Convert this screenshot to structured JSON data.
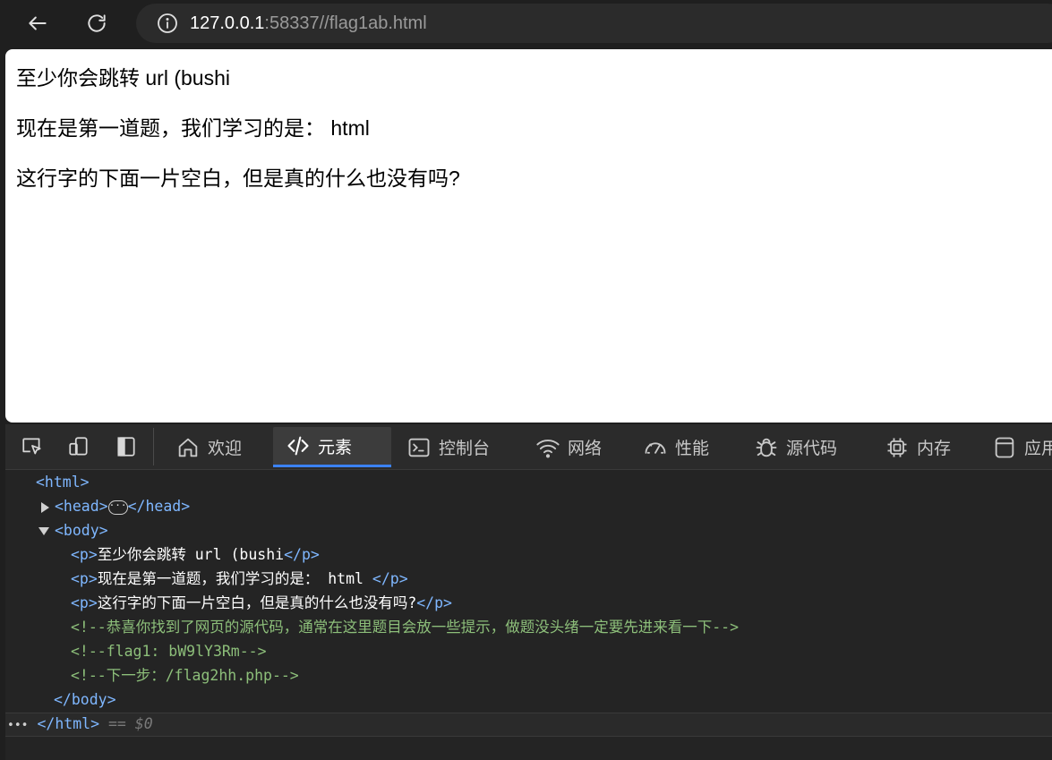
{
  "browser": {
    "url_host": "127.0.0.1",
    "url_rest": ":58337//flag1ab.html",
    "icons": {
      "back": "back-arrow-icon",
      "reload": "reload-icon",
      "info": "info-icon"
    }
  },
  "page": {
    "lines": [
      "至少你会跳转 url (bushi",
      "现在是第一道题，我们学习的是： html",
      "这行字的下面一片空白，但是真的什么也没有吗?"
    ]
  },
  "devtools": {
    "tabs": [
      {
        "label": "欢迎",
        "icon": "home-icon"
      },
      {
        "label": "元素",
        "icon": "code-icon"
      },
      {
        "label": "控制台",
        "icon": "console-icon"
      },
      {
        "label": "网络",
        "icon": "wifi-icon"
      },
      {
        "label": "性能",
        "icon": "gauge-icon"
      },
      {
        "label": "源代码",
        "icon": "bug-icon"
      },
      {
        "label": "内存",
        "icon": "chip-icon"
      },
      {
        "label": "应用",
        "icon": "app-icon"
      }
    ],
    "active_tab": "元素",
    "dom": {
      "html_open": "<html>",
      "head_open": "<head>",
      "head_ellipsis": "···",
      "head_close": "</head>",
      "body_open": "<body>",
      "p_open": "<p>",
      "p_close": "</p>",
      "p1_text": "至少你会跳转 url (bushi",
      "p2_text": "现在是第一道题，我们学习的是： html ",
      "p3_text": "这行字的下面一片空白，但是真的什么也没有吗?",
      "comment1": "<!--恭喜你找到了网页的源代码，通常在这里题目会放一些提示，做题没头绪一定要先进来看一下-->",
      "comment2": "<!--flag1: bW9lY3Rm-->",
      "comment3": "<!--下一步：/flag2hh.php-->",
      "body_close": "</body>",
      "html_close": "</html>",
      "selected_marker": "== $0",
      "row_dots": "•••"
    },
    "colors": {
      "accent": "#3b82f6",
      "tag": "#7fb7ff",
      "comment": "#8dbf7a"
    }
  }
}
